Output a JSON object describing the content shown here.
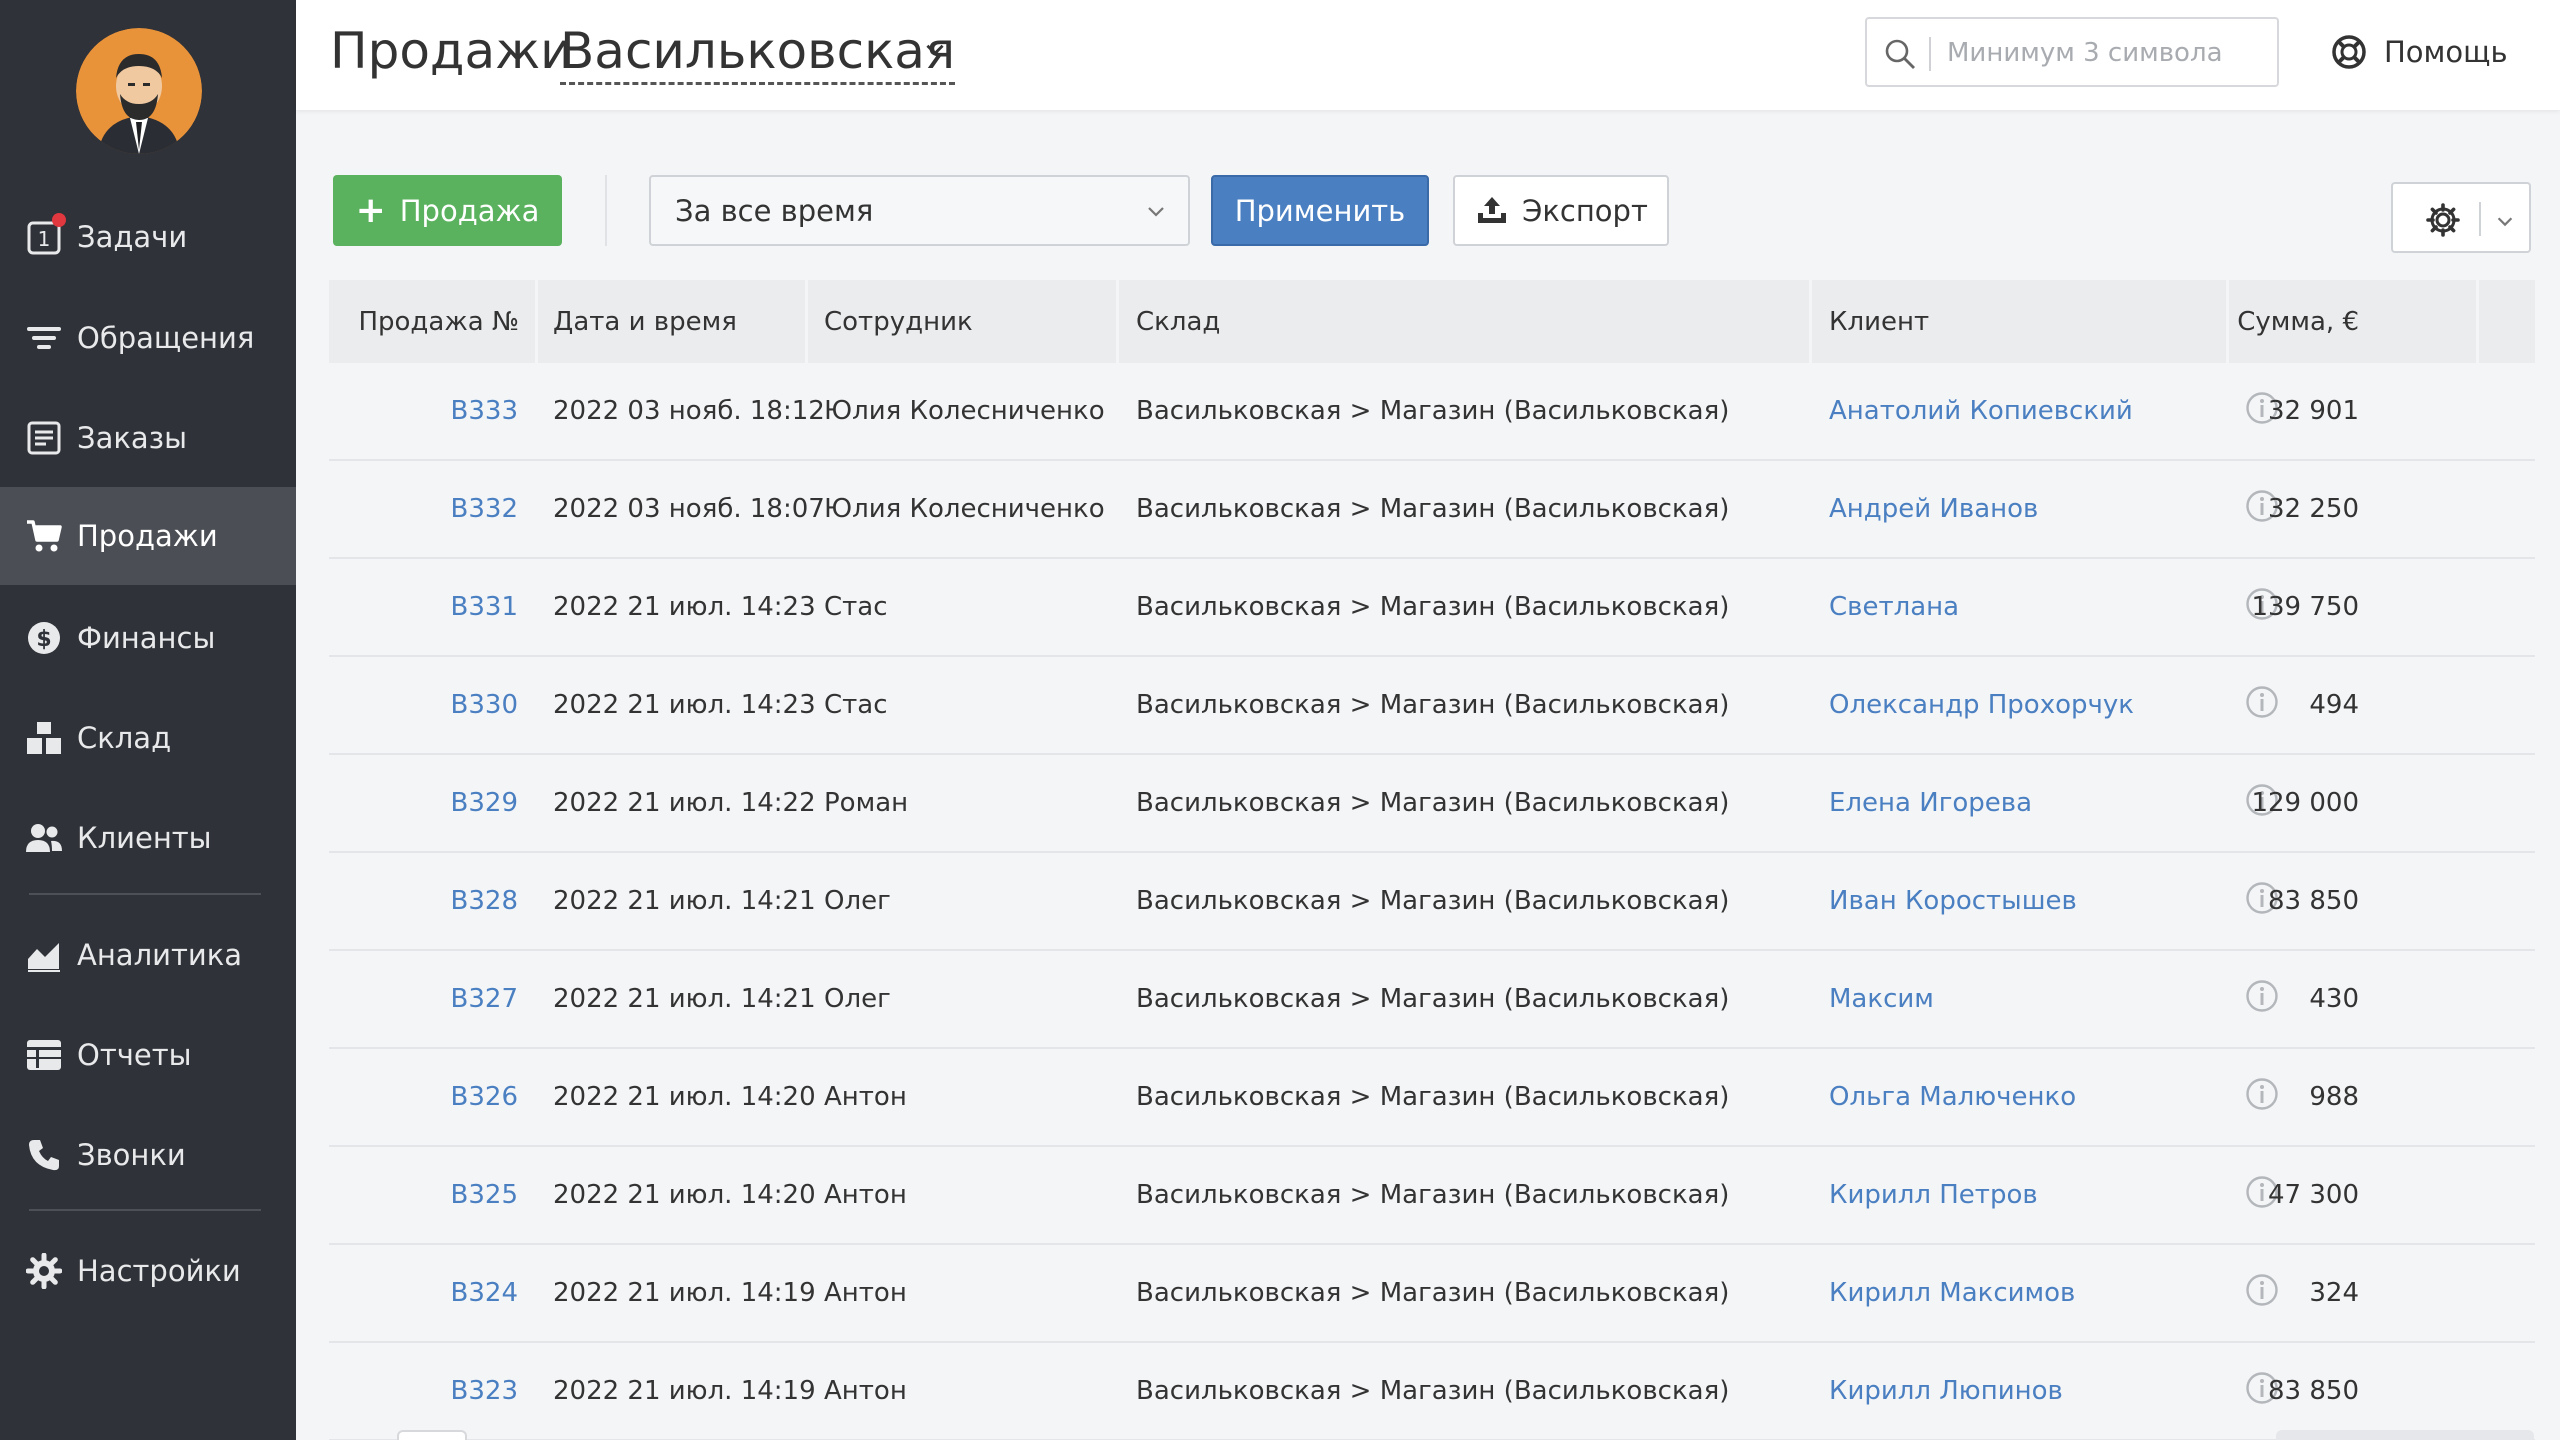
{
  "colors": {
    "sidebar_bg": "#2f3238",
    "sidebar_active": "#4b4e54",
    "accent_blue": "#4a7fc1",
    "accent_green": "#5ab15e",
    "badge_red": "#e0383e"
  },
  "sidebar": {
    "items": [
      {
        "label": "Задачи",
        "icon": "tasks-icon",
        "icon_text": "1"
      },
      {
        "label": "Обращения",
        "icon": "filter-icon"
      },
      {
        "label": "Заказы",
        "icon": "orders-icon"
      },
      {
        "label": "Продажи",
        "icon": "cart-icon",
        "active": true
      },
      {
        "label": "Финансы",
        "icon": "dollar-icon"
      },
      {
        "label": "Склад",
        "icon": "warehouse-icon"
      },
      {
        "label": "Клиенты",
        "icon": "users-icon"
      },
      {
        "label": "Аналитика",
        "icon": "analytics-icon"
      },
      {
        "label": "Отчеты",
        "icon": "reports-icon"
      },
      {
        "label": "Звонки",
        "icon": "phone-icon"
      },
      {
        "label": "Настройки",
        "icon": "gear-icon"
      }
    ]
  },
  "header": {
    "title": "Продажи",
    "location": "Васильковская",
    "search_placeholder": "Минимум 3 символа",
    "help_label": "Помощь"
  },
  "toolbar": {
    "add_label": "Продажа",
    "period_value": "За все время",
    "apply_label": "Применить",
    "export_label": "Экспорт"
  },
  "table": {
    "columns": [
      "Продажа №",
      "Дата и время",
      "Сотрудник",
      "Склад",
      "Клиент",
      "Сумма, €"
    ],
    "rows": [
      {
        "id": "B333",
        "date": "2022 03 нояб. 18:12",
        "employee": "Юлия Колесниченко",
        "warehouse": "Васильковская > Магазин (Васильковская)",
        "client": "Анатолий Копиевский",
        "sum": "32 901"
      },
      {
        "id": "B332",
        "date": "2022 03 нояб. 18:07",
        "employee": "Юлия Колесниченко",
        "warehouse": "Васильковская > Магазин (Васильковская)",
        "client": "Андрей Иванов",
        "sum": "32 250"
      },
      {
        "id": "B331",
        "date": "2022 21 июл. 14:23",
        "employee": "Стас",
        "warehouse": "Васильковская > Магазин (Васильковская)",
        "client": "Светлана",
        "sum": "139 750"
      },
      {
        "id": "B330",
        "date": "2022 21 июл. 14:23",
        "employee": "Стас",
        "warehouse": "Васильковская > Магазин (Васильковская)",
        "client": "Олександр Прохорчук",
        "sum": "494"
      },
      {
        "id": "B329",
        "date": "2022 21 июл. 14:22",
        "employee": "Роман",
        "warehouse": "Васильковская > Магазин (Васильковская)",
        "client": "Елена Игорева",
        "sum": "129 000"
      },
      {
        "id": "B328",
        "date": "2022 21 июл. 14:21",
        "employee": "Олег",
        "warehouse": "Васильковская > Магазин (Васильковская)",
        "client": "Иван Коростышев",
        "sum": "83 850"
      },
      {
        "id": "B327",
        "date": "2022 21 июл. 14:21",
        "employee": "Олег",
        "warehouse": "Васильковская > Магазин (Васильковская)",
        "client": "Максим",
        "sum": "430"
      },
      {
        "id": "B326",
        "date": "2022 21 июл. 14:20",
        "employee": "Антон",
        "warehouse": "Васильковская > Магазин (Васильковская)",
        "client": "Ольга Малюченко",
        "sum": "988"
      },
      {
        "id": "B325",
        "date": "2022 21 июл. 14:20",
        "employee": "Антон",
        "warehouse": "Васильковская > Магазин (Васильковская)",
        "client": "Кирилл Петров",
        "sum": "47 300"
      },
      {
        "id": "B324",
        "date": "2022 21 июл. 14:19",
        "employee": "Антон",
        "warehouse": "Васильковская > Магазин (Васильковская)",
        "client": "Кирилл Максимов",
        "sum": "324"
      },
      {
        "id": "B323",
        "date": "2022 21 июл. 14:19",
        "employee": "Антон",
        "warehouse": "Васильковская > Магазин (Васильковская)",
        "client": "Кирилл Люпинов",
        "sum": "83 850"
      }
    ]
  }
}
